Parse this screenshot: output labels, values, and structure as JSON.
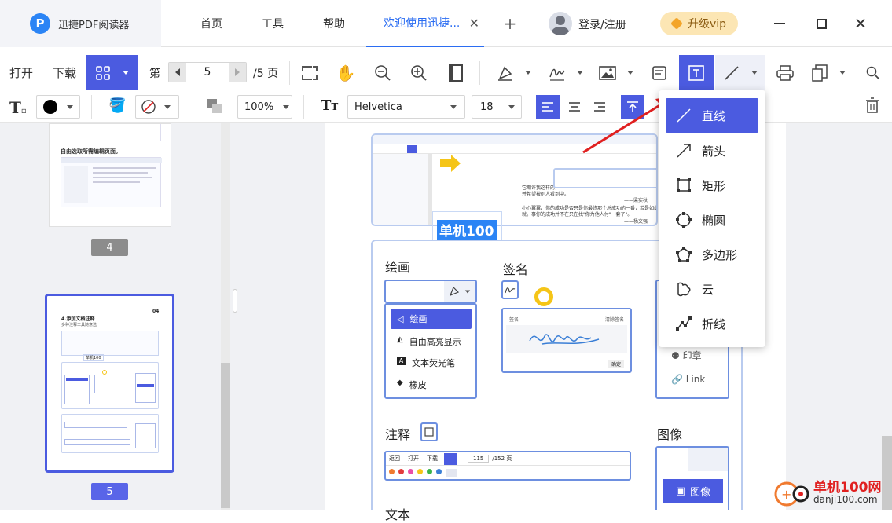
{
  "app": {
    "name": "迅捷PDF阅读器"
  },
  "tabs": [
    {
      "label": "首页"
    },
    {
      "label": "工具"
    },
    {
      "label": "帮助"
    }
  ],
  "active_tab": {
    "label": "欢迎使用迅捷..."
  },
  "header": {
    "login": "登录/注册",
    "vip": "升级vip"
  },
  "toolbar": {
    "open": "打开",
    "download": "下载",
    "page_prefix": "第",
    "page_value": "5",
    "page_total": "/5 页"
  },
  "format": {
    "zoom": "100%",
    "font": "Helvetica",
    "size": "18"
  },
  "sidebar": {
    "pages": [
      {
        "num": "4"
      },
      {
        "num": "5"
      }
    ],
    "thumb_title": "4.添加文档注释",
    "thumb_sub": "多种注释工具随意选",
    "thumb_num": "04",
    "thumb_prev_text": "自由选取所需编辑页面。",
    "thumb_stamp": "单机100"
  },
  "document": {
    "stamp_text": "单机100",
    "sections": {
      "draw": "绘画",
      "sign": "签名",
      "annot": "注释",
      "image": "图像",
      "text": "文本"
    },
    "draw_menu": [
      "绘画",
      "自由高亮显示",
      "文本荧光笔",
      "橡皮"
    ],
    "sign_label": "签名",
    "sign_right": "清除签名",
    "sign_btn": "确定",
    "image_menu": [
      "印章",
      "Link"
    ],
    "image_btn": "图像",
    "mini_bar": [
      "返回",
      "打开",
      "下载"
    ],
    "mini_page": "115",
    "mini_total": "/152 页",
    "preview": {
      "quote1": "它期许我这样的，",
      "quote2": "并希望被别人看到中。",
      "quote3": "——梁实秋",
      "quote4": "小心翼翼，你的成功是否只是你最终那个总成功的一番，若是如此，",
      "quote5": "就。事你的成功并不在只在找\"你为他人付\"一套了\"。",
      "quote6": "——杨文强"
    }
  },
  "dropdown": {
    "items": [
      {
        "label": "直线",
        "icon": "line-icon"
      },
      {
        "label": "箭头",
        "icon": "arrow-icon"
      },
      {
        "label": "矩形",
        "icon": "rectangle-icon"
      },
      {
        "label": "椭圆",
        "icon": "ellipse-icon"
      },
      {
        "label": "多边形",
        "icon": "polygon-icon"
      },
      {
        "label": "云",
        "icon": "cloud-icon"
      },
      {
        "label": "折线",
        "icon": "polyline-icon"
      }
    ]
  },
  "watermark": {
    "text": "单机100网",
    "url": "danji100.com"
  },
  "colors": {
    "accent": "#4b5be0",
    "link": "#2b6df2",
    "arrow": "#e02020"
  }
}
